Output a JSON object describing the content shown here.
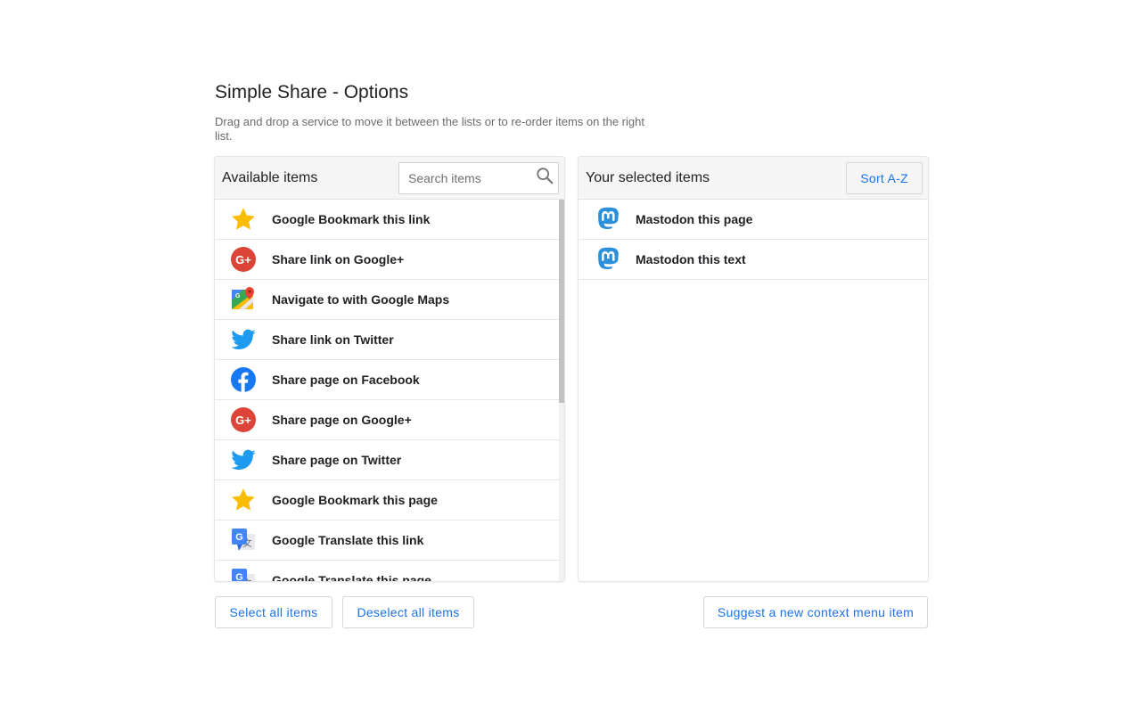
{
  "page": {
    "title": "Simple Share - Options",
    "description": "Drag and drop a service to move it between the lists or to re-order items on the right list."
  },
  "available": {
    "title": "Available items",
    "search_placeholder": "Search items",
    "items": [
      {
        "label": "Google Bookmark this link",
        "icon": "star-icon"
      },
      {
        "label": "Share link on Google+",
        "icon": "google-plus-icon"
      },
      {
        "label": "Navigate to with Google Maps",
        "icon": "google-maps-icon"
      },
      {
        "label": "Share link on Twitter",
        "icon": "twitter-icon"
      },
      {
        "label": "Share page on Facebook",
        "icon": "facebook-icon"
      },
      {
        "label": "Share page on Google+",
        "icon": "google-plus-icon"
      },
      {
        "label": "Share page on Twitter",
        "icon": "twitter-icon"
      },
      {
        "label": "Google Bookmark this page",
        "icon": "star-icon"
      },
      {
        "label": "Google Translate this link",
        "icon": "google-translate-icon"
      },
      {
        "label": "Google Translate this page",
        "icon": "google-translate-icon"
      }
    ]
  },
  "selected": {
    "title": "Your selected items",
    "sort_label": "Sort A-Z",
    "items": [
      {
        "label": "Mastodon this page",
        "icon": "mastodon-icon"
      },
      {
        "label": "Mastodon this text",
        "icon": "mastodon-icon"
      }
    ]
  },
  "footer": {
    "select_all_label": "Select all items",
    "deselect_all_label": "Deselect all items",
    "suggest_label": "Suggest a new context menu item"
  },
  "colors": {
    "accent": "#1a73e8",
    "star": "#fbbc04",
    "google_plus": "#db4437",
    "twitter": "#1d9bf0",
    "facebook": "#1877f2",
    "mastodon": "#2b90d9"
  }
}
